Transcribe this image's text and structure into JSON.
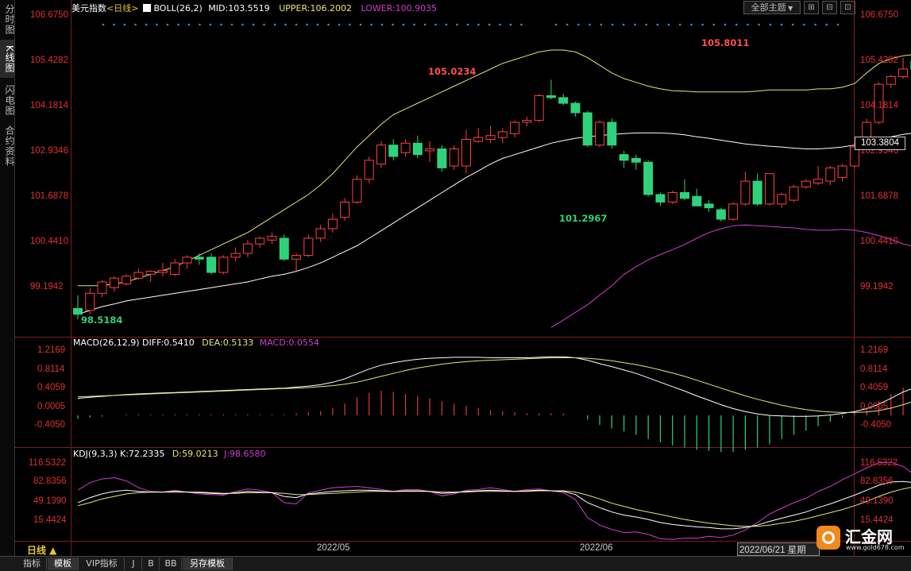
{
  "left_tabs": [
    "分时图",
    "K线图",
    "闪电图",
    "合约资料"
  ],
  "main": {
    "symbol": "美元指数",
    "period_tag": "<日线>",
    "boll_label": "BOLL(26,2)",
    "mid": "MID:103.5519",
    "upper": "UPPER:106.2002",
    "lower": "LOWER:100.9035",
    "theme_button": "全部主题",
    "y_labels": [
      "106.6750",
      "105.4282",
      "104.1814",
      "102.9346",
      "101.6878",
      "100.4410",
      "99.1942"
    ],
    "current_price": "103.3804",
    "annotations": {
      "high": "105.8011",
      "mid_high": "105.0234",
      "low": "101.2967",
      "start_low": "98.5184"
    }
  },
  "macd": {
    "title": "MACD(26,12,9)",
    "diff": "DIFF:0.5410",
    "dea": "DEA:0.5133",
    "macd": "MACD:0.0554",
    "y_labels": [
      "1.2169",
      "0.8114",
      "0.4059",
      "0.0005",
      "-0.4050"
    ]
  },
  "kdj": {
    "title": "KDJ(9,3,3)",
    "k": "K:72.2335",
    "d": "D:59.0213",
    "j": "J:98.6580",
    "y_labels": [
      "116.5322",
      "82.8356",
      "49.1390",
      "15.4424"
    ]
  },
  "x_axis": {
    "labels": [
      "2022/05",
      "2022/06"
    ],
    "cursor_date": "2022/06/21 星期"
  },
  "period_button": "日线 ▲",
  "bottom_tabs": [
    "指标",
    "模板",
    "VIP指标",
    "J",
    "B",
    "BB",
    "另存模板"
  ],
  "watermark": {
    "logo_text": "汇金网",
    "url": "www.gold678.com"
  },
  "colors": {
    "up": "#ff4040",
    "down": "#2fd27a",
    "upper": "#e6e676",
    "mid": "#ffffff",
    "lower": "#d23cd2",
    "dea": "#e6e676",
    "diff": "#ffffff"
  },
  "chart_data": {
    "type": "candlestick",
    "candles": [
      [
        99.0,
        99.35,
        98.72,
        98.85
      ],
      [
        98.95,
        99.55,
        98.85,
        99.4
      ],
      [
        99.4,
        99.75,
        99.3,
        99.7
      ],
      [
        99.55,
        99.85,
        99.45,
        99.8
      ],
      [
        99.65,
        99.9,
        99.6,
        99.85
      ],
      [
        99.8,
        100.05,
        99.75,
        99.95
      ],
      [
        99.9,
        100.0,
        99.7,
        99.98
      ],
      [
        99.95,
        100.2,
        99.85,
        100.0
      ],
      [
        99.9,
        100.3,
        99.85,
        100.2
      ],
      [
        100.2,
        100.4,
        100.05,
        100.35
      ],
      [
        100.35,
        100.45,
        100.15,
        100.3
      ],
      [
        100.35,
        100.45,
        99.9,
        99.95
      ],
      [
        99.95,
        100.4,
        99.9,
        100.35
      ],
      [
        100.35,
        100.6,
        100.25,
        100.45
      ],
      [
        100.45,
        100.8,
        100.35,
        100.7
      ],
      [
        100.7,
        100.9,
        100.6,
        100.85
      ],
      [
        100.8,
        101.0,
        100.7,
        100.9
      ],
      [
        100.85,
        100.95,
        100.25,
        100.3
      ],
      [
        100.3,
        100.45,
        99.95,
        100.4
      ],
      [
        100.4,
        100.95,
        100.35,
        100.85
      ],
      [
        100.85,
        101.2,
        100.75,
        101.1
      ],
      [
        101.1,
        101.5,
        101.0,
        101.35
      ],
      [
        101.4,
        101.9,
        101.3,
        101.8
      ],
      [
        101.8,
        102.5,
        101.75,
        102.4
      ],
      [
        102.4,
        103.0,
        102.3,
        102.9
      ],
      [
        102.8,
        103.4,
        102.7,
        103.3
      ],
      [
        103.3,
        103.45,
        102.9,
        103.0
      ],
      [
        103.1,
        103.45,
        103.0,
        103.35
      ],
      [
        103.35,
        103.55,
        102.95,
        103.05
      ],
      [
        103.15,
        103.4,
        102.85,
        103.2
      ],
      [
        103.2,
        103.3,
        102.6,
        102.7
      ],
      [
        102.75,
        103.3,
        102.65,
        103.2
      ],
      [
        102.75,
        103.7,
        102.55,
        103.45
      ],
      [
        103.4,
        103.75,
        103.35,
        103.5
      ],
      [
        103.45,
        103.8,
        103.35,
        103.55
      ],
      [
        103.5,
        103.75,
        103.35,
        103.65
      ],
      [
        103.6,
        103.95,
        103.5,
        103.9
      ],
      [
        103.9,
        104.05,
        103.8,
        103.95
      ],
      [
        103.95,
        104.65,
        103.9,
        104.6
      ],
      [
        104.6,
        105.02,
        104.5,
        104.55
      ],
      [
        104.55,
        104.65,
        104.35,
        104.4
      ],
      [
        104.4,
        104.45,
        104.05,
        104.15
      ],
      [
        104.15,
        104.2,
        103.25,
        103.3
      ],
      [
        103.3,
        103.95,
        103.25,
        103.9
      ],
      [
        103.9,
        104.0,
        103.2,
        103.3
      ],
      [
        103.05,
        103.15,
        102.7,
        102.9
      ],
      [
        102.95,
        103.05,
        102.65,
        102.85
      ],
      [
        102.85,
        102.9,
        101.95,
        102.0
      ],
      [
        102.0,
        102.05,
        101.7,
        101.8
      ],
      [
        101.8,
        102.1,
        101.75,
        102.05
      ],
      [
        102.05,
        102.4,
        101.85,
        101.9
      ],
      [
        101.95,
        102.15,
        101.7,
        101.7
      ],
      [
        101.75,
        101.85,
        101.55,
        101.65
      ],
      [
        101.6,
        101.65,
        101.29,
        101.35
      ],
      [
        101.35,
        101.8,
        101.3,
        101.75
      ],
      [
        101.75,
        102.6,
        101.7,
        102.35
      ],
      [
        102.35,
        102.55,
        101.7,
        101.75
      ],
      [
        101.75,
        102.55,
        101.7,
        102.55
      ],
      [
        101.75,
        102.05,
        101.65,
        102.0
      ],
      [
        101.85,
        102.25,
        101.8,
        102.2
      ],
      [
        102.2,
        102.4,
        102.15,
        102.35
      ],
      [
        102.3,
        102.75,
        102.25,
        102.4
      ],
      [
        102.35,
        102.75,
        102.25,
        102.7
      ],
      [
        102.45,
        102.8,
        102.35,
        102.75
      ],
      [
        102.75,
        103.35,
        102.7,
        103.25
      ],
      [
        103.25,
        104.0,
        103.2,
        103.9
      ],
      [
        103.9,
        104.95,
        103.85,
        104.9
      ],
      [
        104.9,
        105.15,
        104.8,
        105.1
      ],
      [
        105.1,
        105.6,
        105.05,
        105.3
      ],
      [
        105.5,
        105.8,
        105.4,
        105.3
      ],
      [
        105.2,
        105.25,
        103.6,
        103.85
      ],
      [
        103.85,
        104.9,
        103.7,
        104.8
      ],
      [
        104.8,
        104.95,
        104.35,
        104.55
      ],
      [
        104.6,
        104.7,
        103.95,
        104.4
      ],
      [
        104.4,
        104.6,
        104.05,
        104.25
      ],
      [
        104.25,
        104.9,
        104.05,
        104.35
      ],
      [
        104.35,
        104.45,
        104.15,
        104.4
      ],
      [
        104.4,
        104.55,
        104.0,
        104.1
      ],
      [
        104.1,
        104.25,
        103.8,
        103.95
      ],
      [
        103.95,
        104.5,
        103.8,
        104.5
      ],
      [
        104.45,
        105.05,
        104.4,
        104.95
      ],
      [
        104.95,
        105.0,
        104.9,
        104.92
      ]
    ],
    "y_range": [
      98.3,
      106.95
    ],
    "upper": [
      99.6,
      99.6,
      99.6,
      99.65,
      99.7,
      99.8,
      99.9,
      100.0,
      100.1,
      100.25,
      100.4,
      100.55,
      100.7,
      100.85,
      101.0,
      101.2,
      101.4,
      101.6,
      101.8,
      102.0,
      102.25,
      102.55,
      102.9,
      103.25,
      103.55,
      103.85,
      104.1,
      104.25,
      104.4,
      104.55,
      104.7,
      104.85,
      105.0,
      105.15,
      105.3,
      105.45,
      105.55,
      105.65,
      105.75,
      105.8,
      105.8,
      105.75,
      105.6,
      105.4,
      105.2,
      105.05,
      104.95,
      104.85,
      104.78,
      104.73,
      104.72,
      104.7,
      104.7,
      104.7,
      104.7,
      104.7,
      104.72,
      104.75,
      104.75,
      104.75,
      104.75,
      104.78,
      104.78,
      104.82,
      104.92,
      105.2,
      105.45,
      105.57,
      105.65,
      105.69,
      105.72,
      105.76,
      105.8,
      105.86,
      105.92,
      105.98,
      106.02,
      106.1,
      106.2,
      106.33,
      106.45,
      106.55
    ],
    "mid": [
      98.85,
      98.95,
      99.05,
      99.12,
      99.2,
      99.25,
      99.3,
      99.35,
      99.4,
      99.45,
      99.5,
      99.55,
      99.6,
      99.65,
      99.7,
      99.78,
      99.85,
      99.9,
      99.98,
      100.08,
      100.2,
      100.35,
      100.5,
      100.65,
      100.85,
      101.05,
      101.25,
      101.45,
      101.65,
      101.85,
      102.05,
      102.25,
      102.45,
      102.62,
      102.8,
      102.95,
      103.05,
      103.15,
      103.25,
      103.35,
      103.42,
      103.48,
      103.52,
      103.55,
      103.58,
      103.6,
      103.62,
      103.62,
      103.62,
      103.6,
      103.57,
      103.52,
      103.48,
      103.43,
      103.38,
      103.33,
      103.3,
      103.27,
      103.25,
      103.22,
      103.2,
      103.2,
      103.22,
      103.25,
      103.3,
      103.38,
      103.45,
      103.52,
      103.58,
      103.62,
      103.65,
      103.66,
      103.68,
      103.68,
      103.68,
      103.7,
      103.72,
      103.75,
      103.8,
      103.9,
      104.0,
      104.1
    ],
    "lower": [
      null,
      null,
      null,
      null,
      null,
      null,
      null,
      null,
      null,
      null,
      null,
      null,
      null,
      null,
      null,
      null,
      null,
      null,
      null,
      null,
      null,
      null,
      null,
      null,
      null,
      null,
      null,
      null,
      null,
      null,
      null,
      null,
      null,
      null,
      null,
      null,
      null,
      null,
      null,
      98.5,
      98.7,
      98.9,
      99.1,
      99.35,
      99.6,
      99.9,
      100.1,
      100.28,
      100.42,
      100.55,
      100.68,
      100.85,
      101.0,
      101.1,
      101.18,
      101.2,
      101.18,
      101.16,
      101.14,
      101.12,
      101.08,
      101.06,
      101.06,
      101.08,
      101.06,
      101.0,
      100.92,
      100.82,
      100.7,
      100.62,
      100.6,
      100.58,
      100.58,
      100.58,
      100.58,
      100.58,
      100.56,
      100.58,
      100.62,
      100.65,
      100.75,
      100.85
    ],
    "macd_y_range": [
      -0.6,
      1.4
    ],
    "diff": [
      0.35,
      0.37,
      0.39,
      0.41,
      0.43,
      0.44,
      0.45,
      0.46,
      0.47,
      0.48,
      0.49,
      0.5,
      0.51,
      0.52,
      0.53,
      0.54,
      0.55,
      0.56,
      0.58,
      0.6,
      0.63,
      0.68,
      0.75,
      0.85,
      0.95,
      1.03,
      1.08,
      1.12,
      1.15,
      1.17,
      1.18,
      1.19,
      1.19,
      1.19,
      1.18,
      1.18,
      1.18,
      1.18,
      1.19,
      1.2,
      1.2,
      1.18,
      1.13,
      1.06,
      1.0,
      0.93,
      0.86,
      0.77,
      0.68,
      0.59,
      0.5,
      0.4,
      0.31,
      0.22,
      0.14,
      0.08,
      0.03,
      0.0,
      -0.01,
      -0.02,
      -0.02,
      -0.01,
      0.01,
      0.04,
      0.08,
      0.14,
      0.23,
      0.35,
      0.48,
      0.57,
      0.62,
      0.64,
      0.65,
      0.64,
      0.63,
      0.61,
      0.59,
      0.57,
      0.55,
      0.54,
      0.54,
      0.55
    ],
    "dea": [
      0.38,
      0.39,
      0.4,
      0.41,
      0.42,
      0.43,
      0.44,
      0.45,
      0.46,
      0.47,
      0.48,
      0.49,
      0.5,
      0.51,
      0.52,
      0.53,
      0.54,
      0.55,
      0.56,
      0.57,
      0.59,
      0.61,
      0.64,
      0.68,
      0.74,
      0.8,
      0.86,
      0.92,
      0.97,
      1.01,
      1.05,
      1.08,
      1.1,
      1.12,
      1.13,
      1.14,
      1.15,
      1.16,
      1.17,
      1.18,
      1.18,
      1.18,
      1.17,
      1.15,
      1.12,
      1.08,
      1.04,
      0.99,
      0.93,
      0.87,
      0.8,
      0.72,
      0.64,
      0.56,
      0.48,
      0.4,
      0.33,
      0.27,
      0.21,
      0.16,
      0.12,
      0.09,
      0.07,
      0.06,
      0.06,
      0.07,
      0.1,
      0.15,
      0.22,
      0.3,
      0.37,
      0.43,
      0.47,
      0.5,
      0.52,
      0.53,
      0.53,
      0.53,
      0.52,
      0.52,
      0.51,
      0.51
    ],
    "kdj_y_range": [
      0,
      130
    ],
    "K": [
      60,
      68,
      74,
      78,
      80,
      78,
      77,
      77,
      78,
      77,
      76,
      75,
      74,
      76,
      78,
      77,
      76,
      70,
      68,
      74,
      76,
      78,
      79,
      80,
      80,
      79,
      78,
      79,
      79,
      78,
      75,
      76,
      78,
      79,
      80,
      79,
      78,
      79,
      80,
      79,
      78,
      73,
      60,
      52,
      45,
      40,
      37,
      33,
      28,
      25,
      23,
      21,
      20,
      18,
      18,
      20,
      24,
      30,
      35,
      40,
      45,
      52,
      58,
      65,
      72,
      80,
      88,
      93,
      94,
      92,
      86,
      82,
      80,
      79,
      78,
      77,
      75,
      71,
      66,
      63,
      65,
      72
    ],
    "D": [
      55,
      60,
      66,
      70,
      74,
      76,
      77,
      77,
      77,
      77,
      77,
      76,
      75,
      75,
      76,
      76,
      76,
      75,
      73,
      73,
      74,
      75,
      76,
      77,
      78,
      78,
      78,
      78,
      78,
      78,
      77,
      77,
      77,
      78,
      78,
      78,
      78,
      78,
      79,
      79,
      79,
      77,
      72,
      66,
      59,
      54,
      49,
      45,
      41,
      37,
      33,
      30,
      27,
      25,
      23,
      22,
      22,
      24,
      27,
      30,
      34,
      39,
      44,
      49,
      55,
      62,
      70,
      77,
      82,
      86,
      86,
      85,
      83,
      81,
      80,
      79,
      77,
      75,
      72,
      69,
      66,
      63
    ],
    "J": [
      80,
      92,
      98,
      100,
      95,
      84,
      78,
      77,
      80,
      77,
      74,
      73,
      72,
      78,
      82,
      80,
      76,
      60,
      58,
      76,
      80,
      84,
      85,
      86,
      84,
      81,
      78,
      81,
      81,
      78,
      71,
      74,
      80,
      81,
      84,
      81,
      78,
      81,
      82,
      79,
      76,
      65,
      36,
      24,
      17,
      12,
      13,
      9,
      2,
      1,
      3,
      3,
      6,
      4,
      8,
      16,
      28,
      42,
      51,
      60,
      67,
      78,
      86,
      97,
      106,
      116,
      124,
      125,
      118,
      104,
      86,
      76,
      74,
      75,
      74,
      73,
      71,
      63,
      54,
      51,
      63,
      90
    ]
  }
}
